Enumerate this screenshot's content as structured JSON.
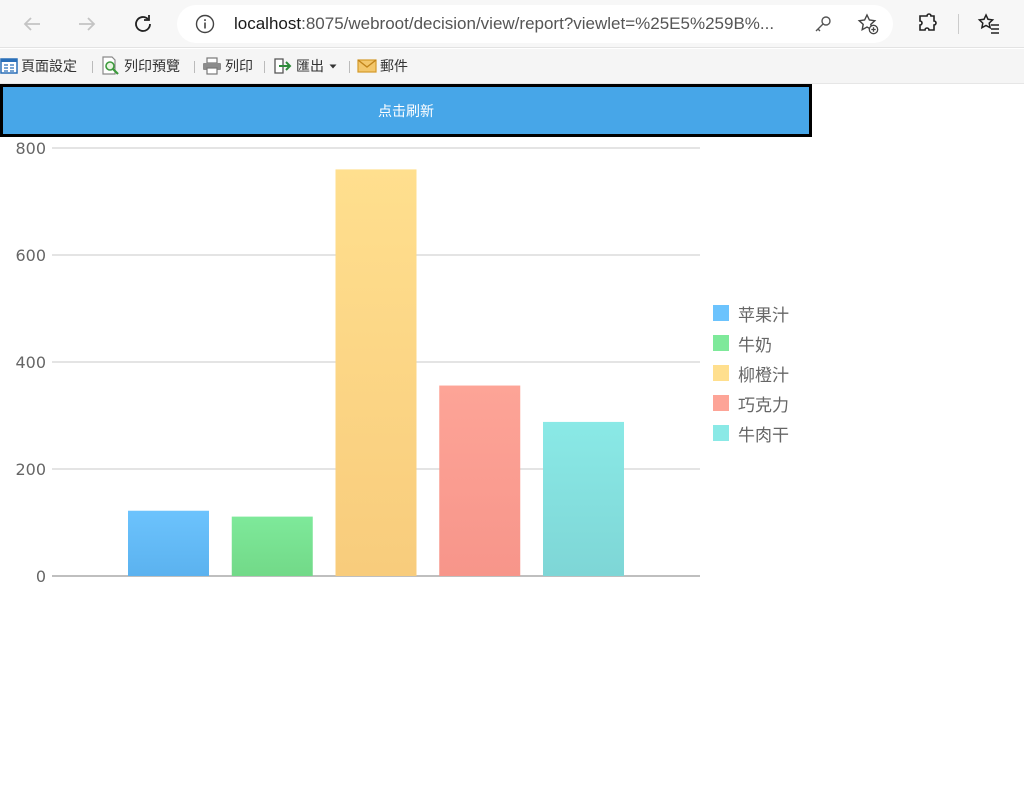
{
  "browser": {
    "url_host": "localhost",
    "url_rest": ":8075/webroot/decision/view/report?viewlet=%25E5%259B%..."
  },
  "toolbar": {
    "page_setup": "頁面設定",
    "print_preview": "列印預覽",
    "print": "列印",
    "export": "匯出",
    "email": "郵件"
  },
  "refresh_button": "点击刷新",
  "chart_data": {
    "type": "bar",
    "categories": [
      "苹果汁",
      "牛奶",
      "柳橙汁",
      "巧克力",
      "牛肉干"
    ],
    "values": [
      122,
      111,
      760,
      356,
      288
    ],
    "colors_top": [
      "#6cc3fd",
      "#7ee99a",
      "#ffdf8e",
      "#fda497",
      "#8ae9e6"
    ],
    "colors_bottom": [
      "#5bb2ef",
      "#72d988",
      "#f8cc7c",
      "#f7958a",
      "#7ed6d6"
    ],
    "ylim": [
      0,
      800
    ],
    "yticks": [
      "0",
      "200",
      "400",
      "600",
      "800"
    ],
    "legend_position": "right",
    "grid": true
  }
}
